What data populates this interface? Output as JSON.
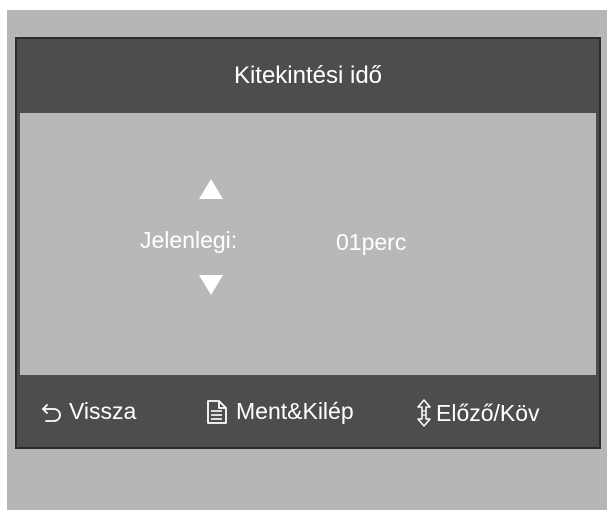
{
  "title": "Kitekintési idő",
  "setting": {
    "label": "Jelenlegi:",
    "value": "01perc",
    "up_arrow_icon": "triangle-up-icon",
    "down_arrow_icon": "triangle-down-icon"
  },
  "footer": {
    "back": {
      "icon": "back-arrow-icon",
      "label": "Vissza"
    },
    "save": {
      "icon": "document-icon",
      "label": "Ment&Kilép"
    },
    "nav": {
      "icon": "up-down-arrow-icon",
      "label": "Előző/Köv"
    }
  },
  "colors": {
    "background_gray": "#b6b6b6",
    "dialog_dark": "#4d4d4d",
    "content_gray": "#b8b8b8",
    "text": "#ffffff"
  }
}
